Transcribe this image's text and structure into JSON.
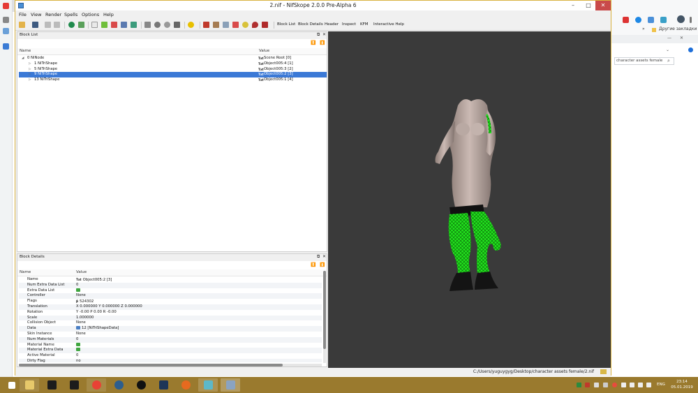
{
  "browser": {
    "bookmarks_label": "Другие закладки",
    "search_text": "character assets female"
  },
  "window": {
    "title": "2.nif - NifSkope 2.0.0 Pre-Alpha 6",
    "minimize": "–",
    "maximize": "□",
    "close": "✕"
  },
  "menu": [
    "File",
    "View",
    "Render",
    "Spells",
    "Options",
    "Help"
  ],
  "toolbar": {
    "tabs": [
      "Block List",
      "Block Details",
      "Header",
      "Inspect",
      "KFM",
      "Interactive Help"
    ]
  },
  "block_list": {
    "title": "Block List",
    "col_name": "Name",
    "col_value": "Value",
    "rows": [
      {
        "name": "0 NiNode",
        "vicon": "Txt",
        "value": "Scene Root [0]",
        "depth": 0,
        "expanded": true,
        "selected": false
      },
      {
        "name": "1 NiTriShape",
        "vicon": "Txt",
        "value": "Object005:4 [1]",
        "depth": 1,
        "expanded": false,
        "selected": false
      },
      {
        "name": "5 NiTriShape",
        "vicon": "Txt",
        "value": "Object005:3 [2]",
        "depth": 1,
        "expanded": false,
        "selected": false
      },
      {
        "name": "9 NiTriShape",
        "vicon": "Txt",
        "value": "Object005:2 [3]",
        "depth": 1,
        "expanded": false,
        "selected": true
      },
      {
        "name": "13 NiTriShape",
        "vicon": "Txt",
        "value": "Object005:1 [4]",
        "depth": 1,
        "expanded": false,
        "selected": false
      }
    ]
  },
  "block_details": {
    "title": "Block Details",
    "col_name": "Name",
    "col_value": "Value",
    "rows": [
      {
        "name": "Name",
        "icon": "txt",
        "icon_text": "Txt",
        "value": "Object005:2 [3]"
      },
      {
        "name": "Num Extra Data List",
        "icon": "",
        "icon_text": "",
        "value": "0"
      },
      {
        "name": "Extra Data List",
        "icon": "green",
        "icon_text": "",
        "value": ""
      },
      {
        "name": "Controller",
        "icon": "",
        "icon_text": "",
        "value": "None"
      },
      {
        "name": "Flags",
        "icon": "flag",
        "icon_text": "β",
        "value": "524302"
      },
      {
        "name": "Translation",
        "icon": "",
        "icon_text": "",
        "value": "X 0.000000 Y 0.000000 Z 0.000000"
      },
      {
        "name": "Rotation",
        "icon": "",
        "icon_text": "",
        "value": "Y -0.00 P 0.00 R -0.00"
      },
      {
        "name": "Scale",
        "icon": "",
        "icon_text": "",
        "value": "1.000000"
      },
      {
        "name": "Collision Object",
        "icon": "",
        "icon_text": "",
        "value": "None"
      },
      {
        "name": "Data",
        "icon": "link",
        "icon_text": "",
        "value": "12 [NiTriShapeData]"
      },
      {
        "name": "Skin Instance",
        "icon": "",
        "icon_text": "",
        "value": "None"
      },
      {
        "name": "Num Materials",
        "icon": "",
        "icon_text": "",
        "value": "0"
      },
      {
        "name": "Material Name",
        "icon": "green",
        "icon_text": "",
        "value": ""
      },
      {
        "name": "Material Extra Data",
        "icon": "green",
        "icon_text": "",
        "value": ""
      },
      {
        "name": "Active Material",
        "icon": "",
        "icon_text": "",
        "value": "0"
      },
      {
        "name": "Dirty Flag",
        "icon": "",
        "icon_text": "",
        "value": "no"
      }
    ]
  },
  "status": {
    "path": "C:/Users/yuguygyg/Desktop/character assets female/2.nif"
  },
  "taskbar": {
    "lang": "ENG",
    "time": "23:14",
    "date": "05.01.2019"
  },
  "colors": {
    "selection": "#3b79d6",
    "viewport_bg": "#3a3a3a",
    "taskbar": "#9a7a2e",
    "wireframe": "#22ff22"
  }
}
